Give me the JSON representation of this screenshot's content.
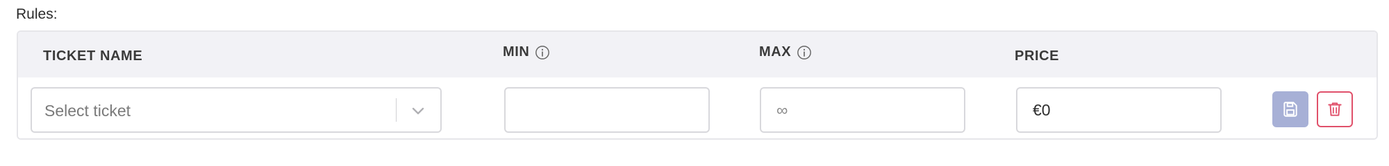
{
  "rules_label": "Rules:",
  "table": {
    "columns": {
      "ticket_name": "TICKET NAME",
      "min": "MIN",
      "max": "MAX",
      "price": "PRICE"
    },
    "row": {
      "ticket_select_placeholder": "Select ticket",
      "min_value": "",
      "max_placeholder": "∞",
      "price_value": "€0"
    }
  },
  "icons": {
    "min_info": "info-icon",
    "max_info": "info-icon",
    "select_chevron": "chevron-down-icon",
    "save": "floppy-disk-icon",
    "delete": "trash-icon"
  },
  "colors": {
    "save_button": "#a7b0d6",
    "delete_button_border": "#e0506a",
    "header_background": "#f2f2f6"
  }
}
